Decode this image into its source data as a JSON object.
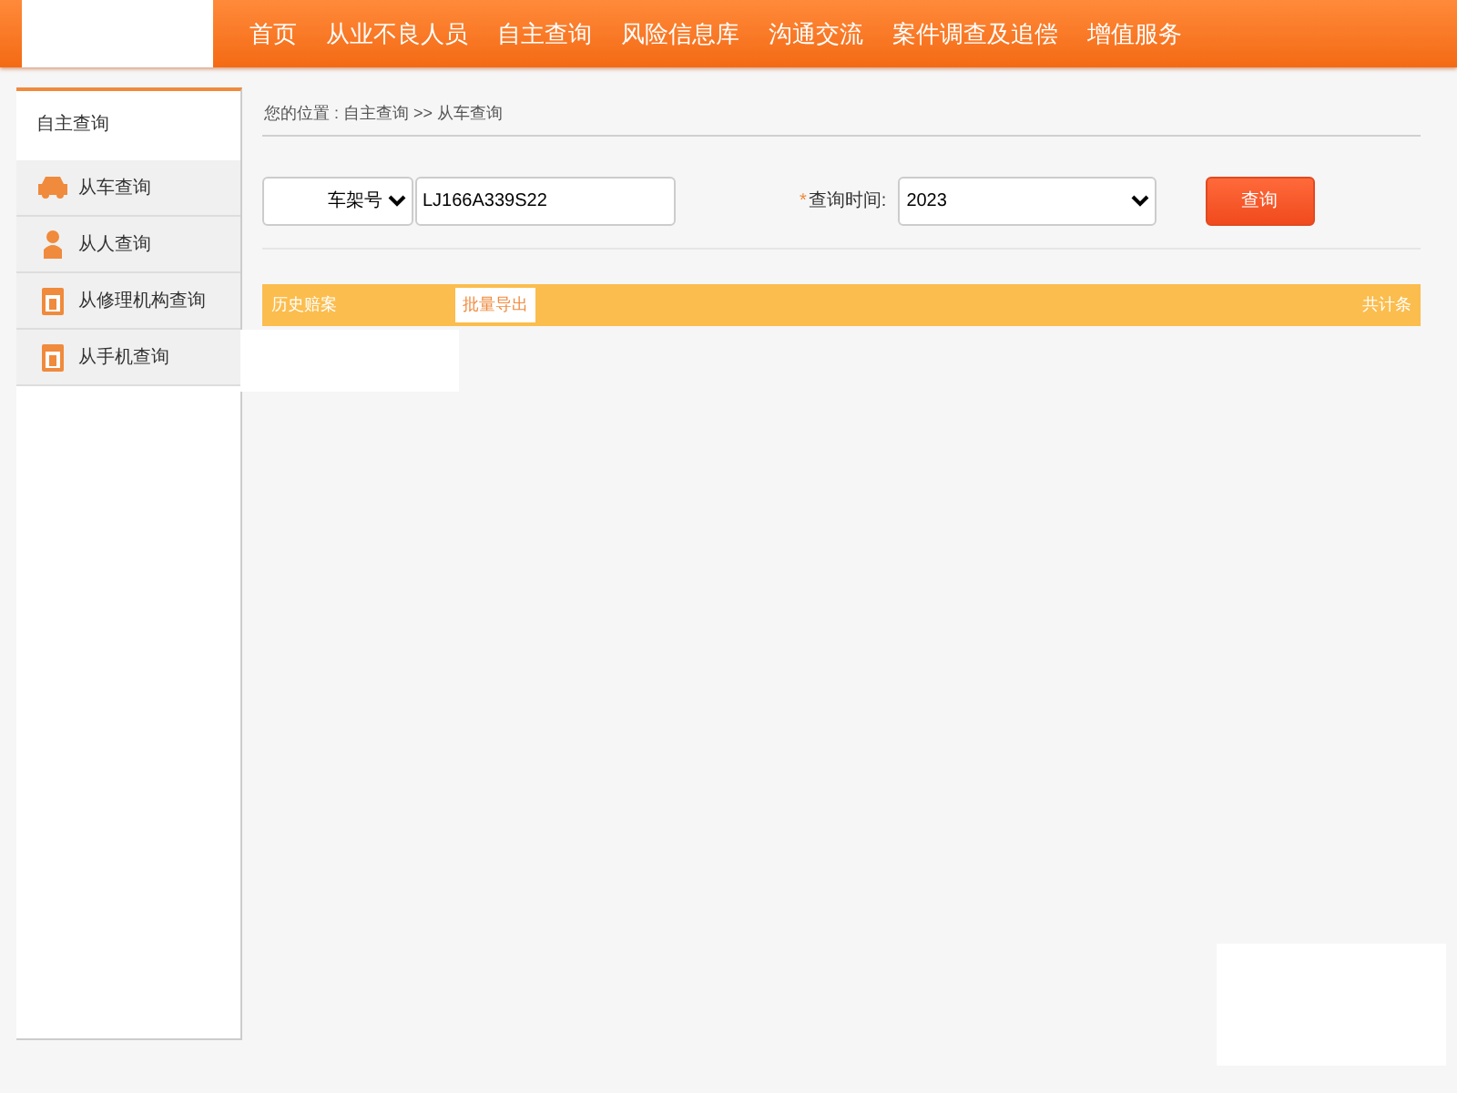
{
  "nav": [
    {
      "label": "首页"
    },
    {
      "label": "从业不良人员"
    },
    {
      "label": "自主查询"
    },
    {
      "label": "风险信息库"
    },
    {
      "label": "沟通交流"
    },
    {
      "label": "案件调查及追偿"
    },
    {
      "label": "增值服务"
    }
  ],
  "sidebar": {
    "title": "自主查询",
    "items": [
      {
        "label": "从车查询",
        "kind": "car"
      },
      {
        "label": "从人查询",
        "kind": "person"
      },
      {
        "label": "从修理机构查询",
        "kind": "shop"
      },
      {
        "label": "从手机查询",
        "kind": "shop"
      }
    ]
  },
  "breadcrumb": "您的位置 : 自主查询 >> 从车查询",
  "form": {
    "field_type": "车架号",
    "vin": "LJ166A339S22",
    "time_label": "查询时间:",
    "required_mark": "*",
    "year": "2023",
    "submit": "查询"
  },
  "results": {
    "title": "历史赔案",
    "export": "批量导出",
    "count": "共计条"
  }
}
